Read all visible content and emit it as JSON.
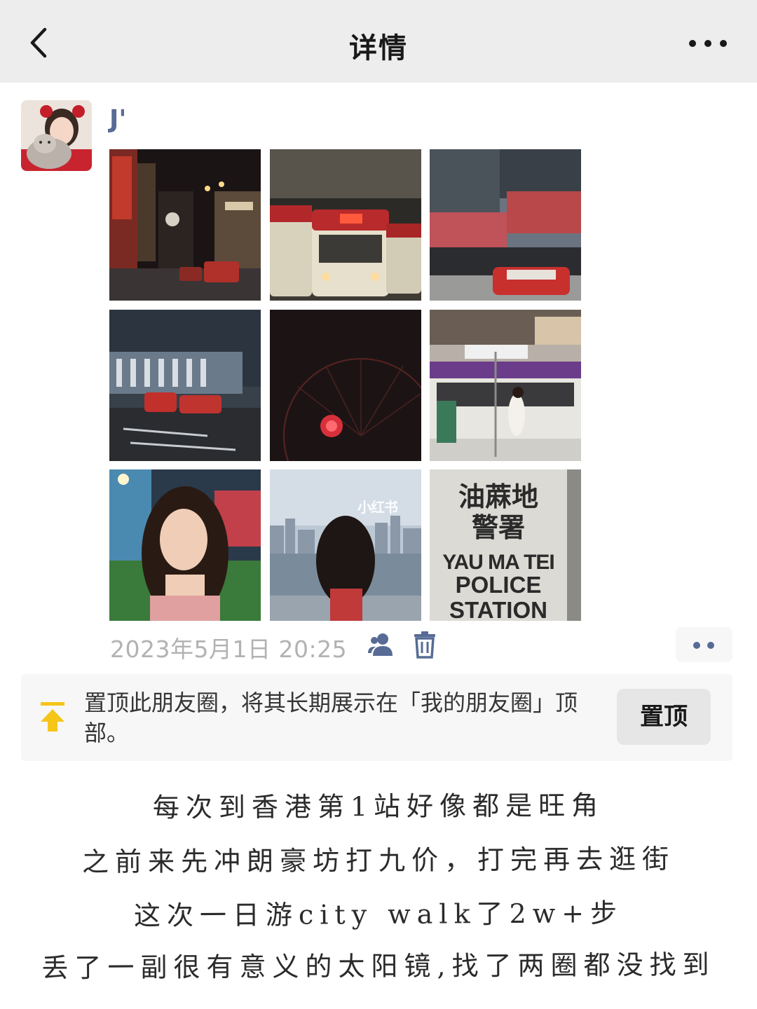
{
  "header": {
    "title": "详情",
    "back_icon": "chevron-left-icon",
    "more_icon": "ellipsis-icon"
  },
  "post": {
    "username": "J'",
    "photos": [
      {
        "desc": "night-street-signs"
      },
      {
        "desc": "red-minibuses"
      },
      {
        "desc": "building-red-taxi"
      },
      {
        "desc": "taxis-on-road"
      },
      {
        "desc": "ferris-wheel-night"
      },
      {
        "desc": "tram-street-sign"
      },
      {
        "desc": "portrait-woman"
      },
      {
        "desc": "harbour-view-woman"
      },
      {
        "desc": "police-station-sign"
      }
    ],
    "watermark": "小红书",
    "police_sign": {
      "line1": "油蔴地",
      "line2": "警署",
      "line3": "YAU MA TEI",
      "line4": "POLICE",
      "line5": "STATION"
    },
    "timestamp": "2023年5月1日 20:25",
    "visibility_icon": "friends-icon",
    "delete_icon": "trash-icon",
    "actions_icon": "two-dots-icon"
  },
  "pin_banner": {
    "text": "置顶此朋友圈，将其长期展示在「我的朋友圈」顶部。",
    "button_label": "置顶",
    "icon": "pin-top-icon",
    "accent_color": "#f5c518"
  },
  "caption": {
    "line1": "每次到香港第1站好像都是旺角",
    "line2": "之前来先冲朗豪坊打九价，打完再去逛街",
    "line3": "这次一日游city walk了2w+步",
    "line4": "丢了一副很有意义的太阳镜,找了两圈都没找到"
  },
  "colors": {
    "header_bg": "#ededed",
    "username": "#576b95",
    "timestamp": "#b2b2b2",
    "banner_bg": "#f7f7f7"
  }
}
